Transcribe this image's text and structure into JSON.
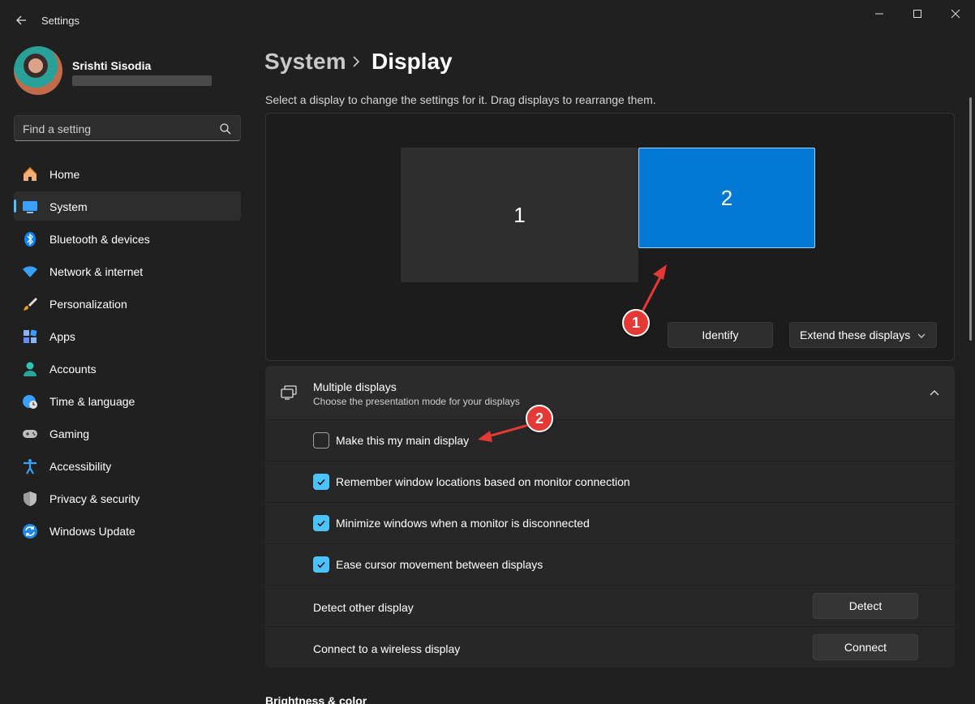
{
  "window": {
    "title": "Settings",
    "controls": [
      "minimize-icon",
      "maximize-icon",
      "close-icon"
    ]
  },
  "user": {
    "name": "Srishti Sisodia"
  },
  "search": {
    "placeholder": "Find a setting"
  },
  "sidebar": {
    "items": [
      {
        "label": "Home",
        "icon": "home-icon"
      },
      {
        "label": "System",
        "icon": "system-icon",
        "active": true
      },
      {
        "label": "Bluetooth & devices",
        "icon": "bluetooth-icon"
      },
      {
        "label": "Network & internet",
        "icon": "wifi-icon"
      },
      {
        "label": "Personalization",
        "icon": "brush-icon"
      },
      {
        "label": "Apps",
        "icon": "apps-icon"
      },
      {
        "label": "Accounts",
        "icon": "account-icon"
      },
      {
        "label": "Time & language",
        "icon": "globe-clock-icon"
      },
      {
        "label": "Gaming",
        "icon": "gamepad-icon"
      },
      {
        "label": "Accessibility",
        "icon": "accessibility-icon"
      },
      {
        "label": "Privacy & security",
        "icon": "shield-icon"
      },
      {
        "label": "Windows Update",
        "icon": "update-icon"
      }
    ]
  },
  "header": {
    "parent": "System",
    "current": "Display"
  },
  "arrangement": {
    "hint": "Select a display to change the settings for it. Drag displays to rearrange them.",
    "monitor1": "1",
    "monitor2": "2",
    "identify_label": "Identify",
    "mode_label": "Extend these displays"
  },
  "annotations": {
    "first": "1",
    "second": "2"
  },
  "multiple_displays": {
    "title": "Multiple displays",
    "subtitle": "Choose the presentation mode for your displays",
    "options": [
      {
        "label": "Make this my main display",
        "checked": false
      },
      {
        "label": "Remember window locations based on monitor connection",
        "checked": true
      },
      {
        "label": "Minimize windows when a monitor is disconnected",
        "checked": true
      },
      {
        "label": "Ease cursor movement between displays",
        "checked": true
      }
    ],
    "detect": {
      "label": "Detect other display",
      "button": "Detect"
    },
    "wireless": {
      "label": "Connect to a wireless display",
      "button": "Connect"
    }
  },
  "next_section": "Brightness & color",
  "colors": {
    "accent": "#4cc2ff",
    "selected_monitor": "#0078d4",
    "annotation": "#e53935"
  }
}
